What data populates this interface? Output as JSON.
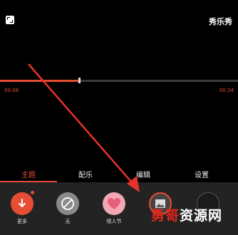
{
  "header": {
    "brand": "秀乐秀"
  },
  "player": {
    "current_time": "00:08",
    "total_time": "00:24",
    "progress": 0.333
  },
  "tabs": [
    {
      "label": "主题",
      "active": true
    },
    {
      "label": "配乐",
      "active": false
    },
    {
      "label": "编辑",
      "active": false
    },
    {
      "label": "设置",
      "active": false
    }
  ],
  "themes": [
    {
      "label": "更多",
      "icon": "download-icon"
    },
    {
      "label": "无",
      "icon": "no-entry-icon"
    },
    {
      "label": "情人节",
      "icon": "heart-icon"
    },
    {
      "label": "",
      "icon": "image-icon"
    },
    {
      "label": "",
      "icon": "image-icon"
    }
  ],
  "watermark": {
    "part1": "勇哥",
    "part2": "资源网"
  },
  "colors": {
    "accent": "#e74c35",
    "background": "#000000",
    "panel": "#232323"
  }
}
